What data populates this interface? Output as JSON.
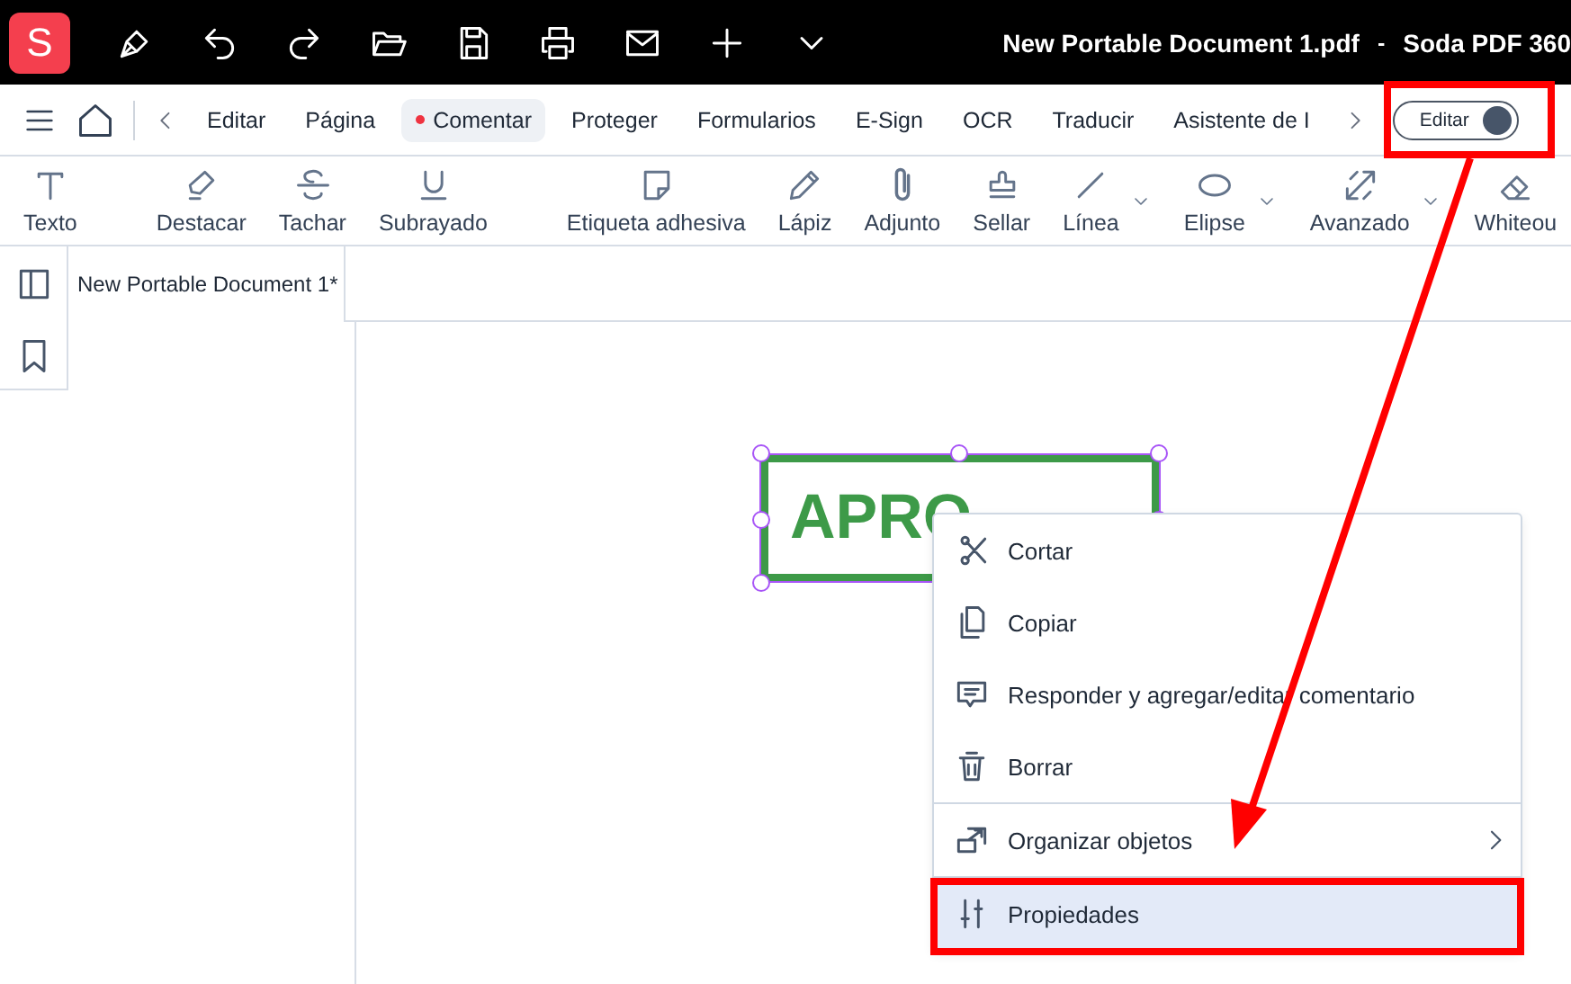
{
  "title_bar": {
    "logo": "S",
    "title": "New Portable Document 1.pdf",
    "separator": "-",
    "app_name": "Soda PDF 360"
  },
  "nav": {
    "items": [
      {
        "label": "Editar",
        "selected": false
      },
      {
        "label": "Página",
        "selected": false
      },
      {
        "label": "Comentar",
        "selected": true
      },
      {
        "label": "Proteger",
        "selected": false
      },
      {
        "label": "Formularios",
        "selected": false
      },
      {
        "label": "E-Sign",
        "selected": false
      },
      {
        "label": "OCR",
        "selected": false
      },
      {
        "label": "Traducir",
        "selected": false
      },
      {
        "label": "Asistente de I",
        "selected": false
      }
    ],
    "mode_toggle": {
      "label": "Editar",
      "on": true
    }
  },
  "toolbar": {
    "groups": [
      [
        {
          "label": "Texto",
          "dropdown": false
        }
      ],
      [
        {
          "label": "Destacar",
          "dropdown": false
        },
        {
          "label": "Tachar",
          "dropdown": false
        },
        {
          "label": "Subrayado",
          "dropdown": false
        }
      ],
      [
        {
          "label": "Etiqueta adhesiva",
          "dropdown": false
        },
        {
          "label": "Lápiz",
          "dropdown": false
        },
        {
          "label": "Adjunto",
          "dropdown": false
        },
        {
          "label": "Sellar",
          "dropdown": false
        },
        {
          "label": "Línea",
          "dropdown": true
        },
        {
          "label": "Elipse",
          "dropdown": true
        },
        {
          "label": "Avanzado",
          "dropdown": true
        },
        {
          "label": "Whiteou",
          "dropdown": false
        }
      ]
    ]
  },
  "document_tab": {
    "label": "New Portable Document 1*"
  },
  "stamp": {
    "text": "APRO",
    "selected": true
  },
  "context_menu": {
    "items": [
      {
        "label": "Cortar",
        "selected": false,
        "submenu": false,
        "divider_before": false
      },
      {
        "label": "Copiar",
        "selected": false,
        "submenu": false,
        "divider_before": false
      },
      {
        "label": "Responder y agregar/editar comentario",
        "selected": false,
        "submenu": false,
        "divider_before": false
      },
      {
        "label": "Borrar",
        "selected": false,
        "submenu": false,
        "divider_before": false
      },
      {
        "label": "Organizar objetos",
        "selected": false,
        "submenu": true,
        "divider_before": true
      },
      {
        "label": "Propiedades",
        "selected": true,
        "submenu": false,
        "divider_before": true
      }
    ]
  }
}
